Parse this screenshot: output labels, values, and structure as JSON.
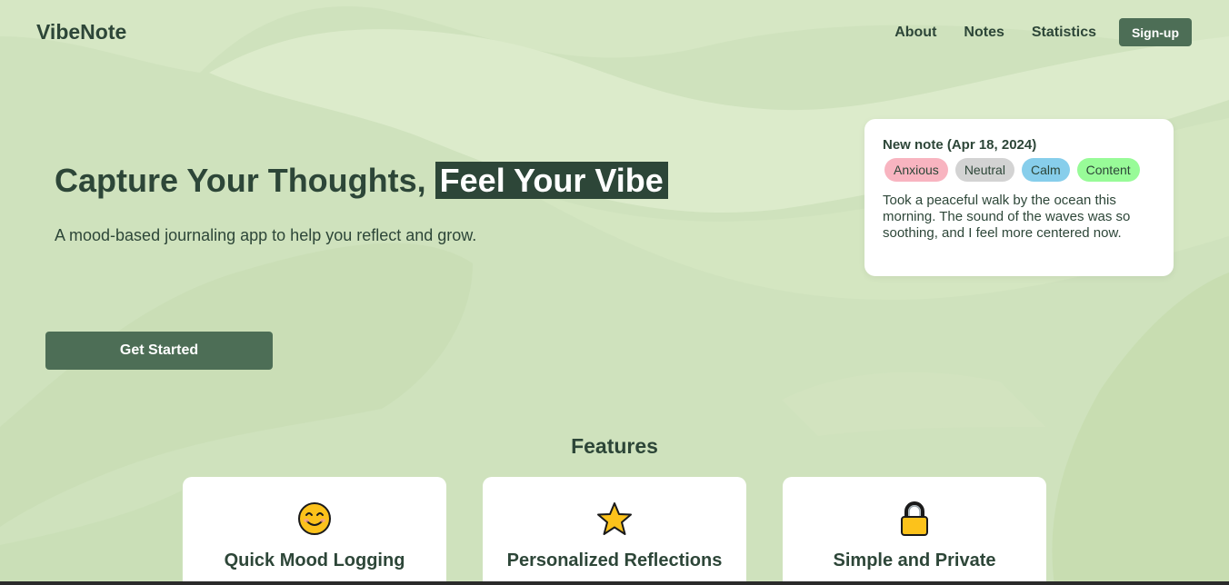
{
  "header": {
    "logo": "VibeNote",
    "nav": [
      "About",
      "Notes",
      "Statistics"
    ],
    "signup_label": "Sign-up"
  },
  "hero": {
    "title_part1": "Capture Your Thoughts, ",
    "title_highlight": "Feel Your Vibe",
    "subtitle": "A mood-based journaling app to help you reflect and grow.",
    "cta_label": "Get Started"
  },
  "note_card": {
    "title": "New note (Apr 18, 2024)",
    "tags": [
      {
        "label": "Anxious",
        "color": "#f8b4c0"
      },
      {
        "label": "Neutral",
        "color": "#d3d3d3"
      },
      {
        "label": "Calm",
        "color": "#87ceeb"
      },
      {
        "label": "Content",
        "color": "#98fb98"
      }
    ],
    "text": "Took a peaceful walk by the ocean this morning. The sound of the waves was so soothing, and I feel more centered now."
  },
  "features": {
    "title": "Features",
    "items": [
      {
        "title": "Quick Mood Logging",
        "icon": "smiley-icon"
      },
      {
        "title": "Personalized Reflections",
        "icon": "star-icon"
      },
      {
        "title": "Simple and Private",
        "icon": "lock-icon"
      }
    ]
  },
  "colors": {
    "background": "#cfe2bd",
    "primary": "#4d6e56",
    "text": "#2d4638"
  }
}
